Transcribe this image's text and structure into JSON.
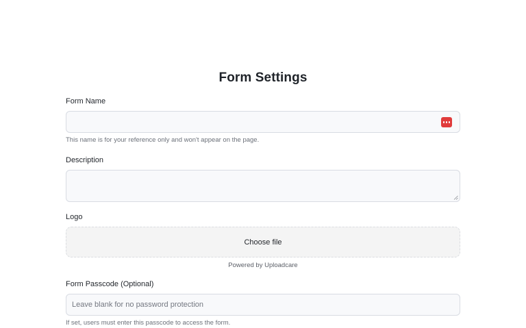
{
  "page": {
    "title": "Form Settings"
  },
  "form_name": {
    "label": "Form Name",
    "value": "",
    "help": "This name is for your reference only and won't appear on the page.",
    "icon": "password-manager-icon"
  },
  "description": {
    "label": "Description",
    "value": ""
  },
  "logo": {
    "label": "Logo",
    "button_label": "Choose file",
    "powered_by": "Powered by Uploadcare"
  },
  "passcode": {
    "label": "Form Passcode (Optional)",
    "placeholder": "Leave blank for no password protection",
    "help": "If set, users must enter this passcode to access the form."
  },
  "colors": {
    "pw_icon": "#e03b3b",
    "input_bg": "#f8f9fb",
    "input_border": "#d8dbe2"
  }
}
